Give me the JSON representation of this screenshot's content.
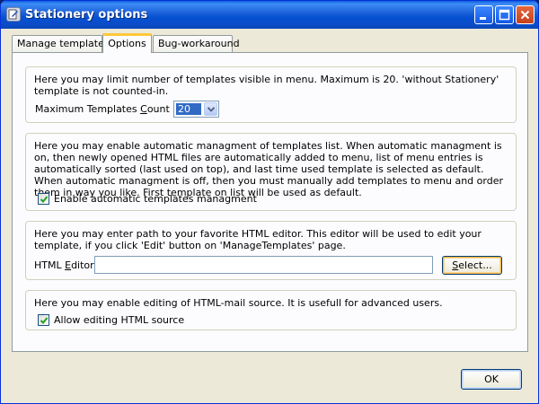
{
  "window": {
    "title": "Stationery options",
    "app_icon": "stationery-app-icon",
    "controls": [
      "minimize-icon",
      "maximize-icon",
      "close-icon"
    ],
    "accent_color": "#0a5fe0",
    "close_color": "#c7401a"
  },
  "tabs": [
    {
      "label": "Manage templates",
      "active": false
    },
    {
      "label": "Options",
      "active": true
    },
    {
      "label": "Bug-workaround",
      "active": false
    }
  ],
  "groups": {
    "templates_count": {
      "description": "Here you may limit number of templates visible in menu. Maximum is 20. 'without Stationery' template is not counted-in.",
      "label_pre": "Maximum Templates ",
      "label_hot": "C",
      "label_post": "ount",
      "combo_value": "20"
    },
    "auto_manage": {
      "description": "Here you may enable automatic managment of templates list. When automatic managment is on, then newly opened HTML files are automatically added to menu, list of menu entries is automatically sorted (last used on top), and last time used template is selected as default. When automatic managment is off, then you must manually add templates to menu and order them in way you like. First template on list will be used as default.",
      "checkbox_label": "Enable automatic templates managment",
      "checked": true
    },
    "html_editor": {
      "description": "Here you may enter path to your favorite HTML editor. This editor will be used to edit your template, if you click 'Edit' button on 'ManageTemplates' page.",
      "label_pre": "HTML ",
      "label_hot": "E",
      "label_post": "ditor",
      "value": "",
      "select_pre": "",
      "select_hot": "S",
      "select_post": "elect..."
    },
    "html_source": {
      "description": "Here you may enable editing of HTML-mail source. It is usefull for advanced users.",
      "checkbox_label": "Allow editing HTML source",
      "checked": true
    }
  },
  "footer": {
    "ok_label": "OK"
  }
}
